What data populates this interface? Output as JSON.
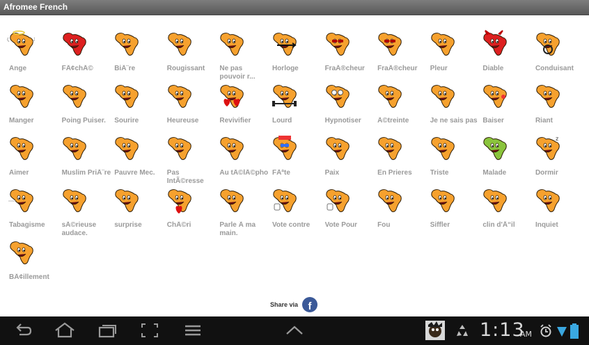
{
  "app": {
    "title": "Afromee French"
  },
  "colors": {
    "face": "#f6a12e",
    "outline": "#2a1a05",
    "label": "#9a9a9a",
    "facebook": "#3b5998"
  },
  "emoticons": [
    {
      "label": "Ange",
      "icon": "angel-face-icon"
    },
    {
      "label": "FÃ¢chÃ©",
      "icon": "angry-face-icon"
    },
    {
      "label": "BiÃ¨re",
      "icon": "beer-face-icon"
    },
    {
      "label": "Rougissant",
      "icon": "blushing-face-icon"
    },
    {
      "label": "Ne pas pouvoir r...",
      "icon": "cannot-face-icon"
    },
    {
      "label": "Horloge",
      "icon": "clock-face-icon"
    },
    {
      "label": "FraÃ®cheur",
      "icon": "cool-face-icon"
    },
    {
      "label": "FraÃ®cheur",
      "icon": "cool-face-2-icon"
    },
    {
      "label": "Pleur",
      "icon": "crying-face-icon"
    },
    {
      "label": "Diable",
      "icon": "devil-face-icon"
    },
    {
      "label": "Conduisant",
      "icon": "driving-face-icon"
    },
    {
      "label": "Manger",
      "icon": "eating-face-icon"
    },
    {
      "label": "Poing Puiser.",
      "icon": "fist-face-icon"
    },
    {
      "label": "Sourire",
      "icon": "smile-face-icon"
    },
    {
      "label": "Heureuse",
      "icon": "happy-face-icon"
    },
    {
      "label": "Revivifier",
      "icon": "revive-face-icon"
    },
    {
      "label": "Lourd",
      "icon": "heavy-face-icon"
    },
    {
      "label": "Hypnotiser",
      "icon": "hypnotize-face-icon"
    },
    {
      "label": "Ã©treinte",
      "icon": "hug-face-icon"
    },
    {
      "label": "Je ne sais pas",
      "icon": "dont-know-face-icon"
    },
    {
      "label": "Baiser",
      "icon": "kiss-face-icon"
    },
    {
      "label": "Riant",
      "icon": "laughing-face-icon"
    },
    {
      "label": "Aimer",
      "icon": "love-face-icon"
    },
    {
      "label": "Muslim PriÃ¨re",
      "icon": "prayer-face-icon"
    },
    {
      "label": "Pauvre Mec.",
      "icon": "poor-guy-face-icon"
    },
    {
      "label": "Pas IntÃ©resse",
      "icon": "not-interested-face-icon"
    },
    {
      "label": "Au tÃ©lÃ©pho",
      "icon": "phone-face-icon"
    },
    {
      "label": "FÃªte",
      "icon": "party-face-icon"
    },
    {
      "label": "Paix",
      "icon": "peace-face-icon"
    },
    {
      "label": "En Prieres",
      "icon": "praying-face-icon"
    },
    {
      "label": "Triste",
      "icon": "sad-face-icon"
    },
    {
      "label": "Malade",
      "icon": "sick-face-icon"
    },
    {
      "label": "Dormir",
      "icon": "sleeping-face-icon"
    },
    {
      "label": "Tabagisme",
      "icon": "smoking-face-icon"
    },
    {
      "label": "sÃ©rieuse audace.",
      "icon": "serious-face-icon"
    },
    {
      "label": "surprise",
      "icon": "surprise-face-icon"
    },
    {
      "label": "ChÃ©ri",
      "icon": "darling-face-icon"
    },
    {
      "label": "Parle Ã  ma main.",
      "icon": "talk-to-hand-face-icon"
    },
    {
      "label": "Vote contre",
      "icon": "thumbs-down-face-icon"
    },
    {
      "label": "Vote Pour",
      "icon": "thumbs-up-face-icon"
    },
    {
      "label": "Fou",
      "icon": "crazy-face-icon"
    },
    {
      "label": "Siffler",
      "icon": "whistle-face-icon"
    },
    {
      "label": "clin d'Å“il",
      "icon": "wink-face-icon"
    },
    {
      "label": "Inquiet",
      "icon": "worried-face-icon"
    },
    {
      "label": "BÃ¢illement",
      "icon": "yawn-face-icon"
    }
  ],
  "share": {
    "label": "Share via",
    "icon": "facebook-icon",
    "icon_glyph": "f"
  },
  "statusbar": {
    "nav_icons": [
      "back-icon",
      "home-icon",
      "recent-apps-icon",
      "screenshot-icon",
      "menu-icon",
      "chevron-up-icon"
    ],
    "notification_icons": [
      "app-notification-icon",
      "recycle-icon"
    ],
    "time": "1:13",
    "ampm": "AM",
    "status_icons": [
      "alarm-icon",
      "wifi-icon",
      "battery-icon"
    ]
  }
}
